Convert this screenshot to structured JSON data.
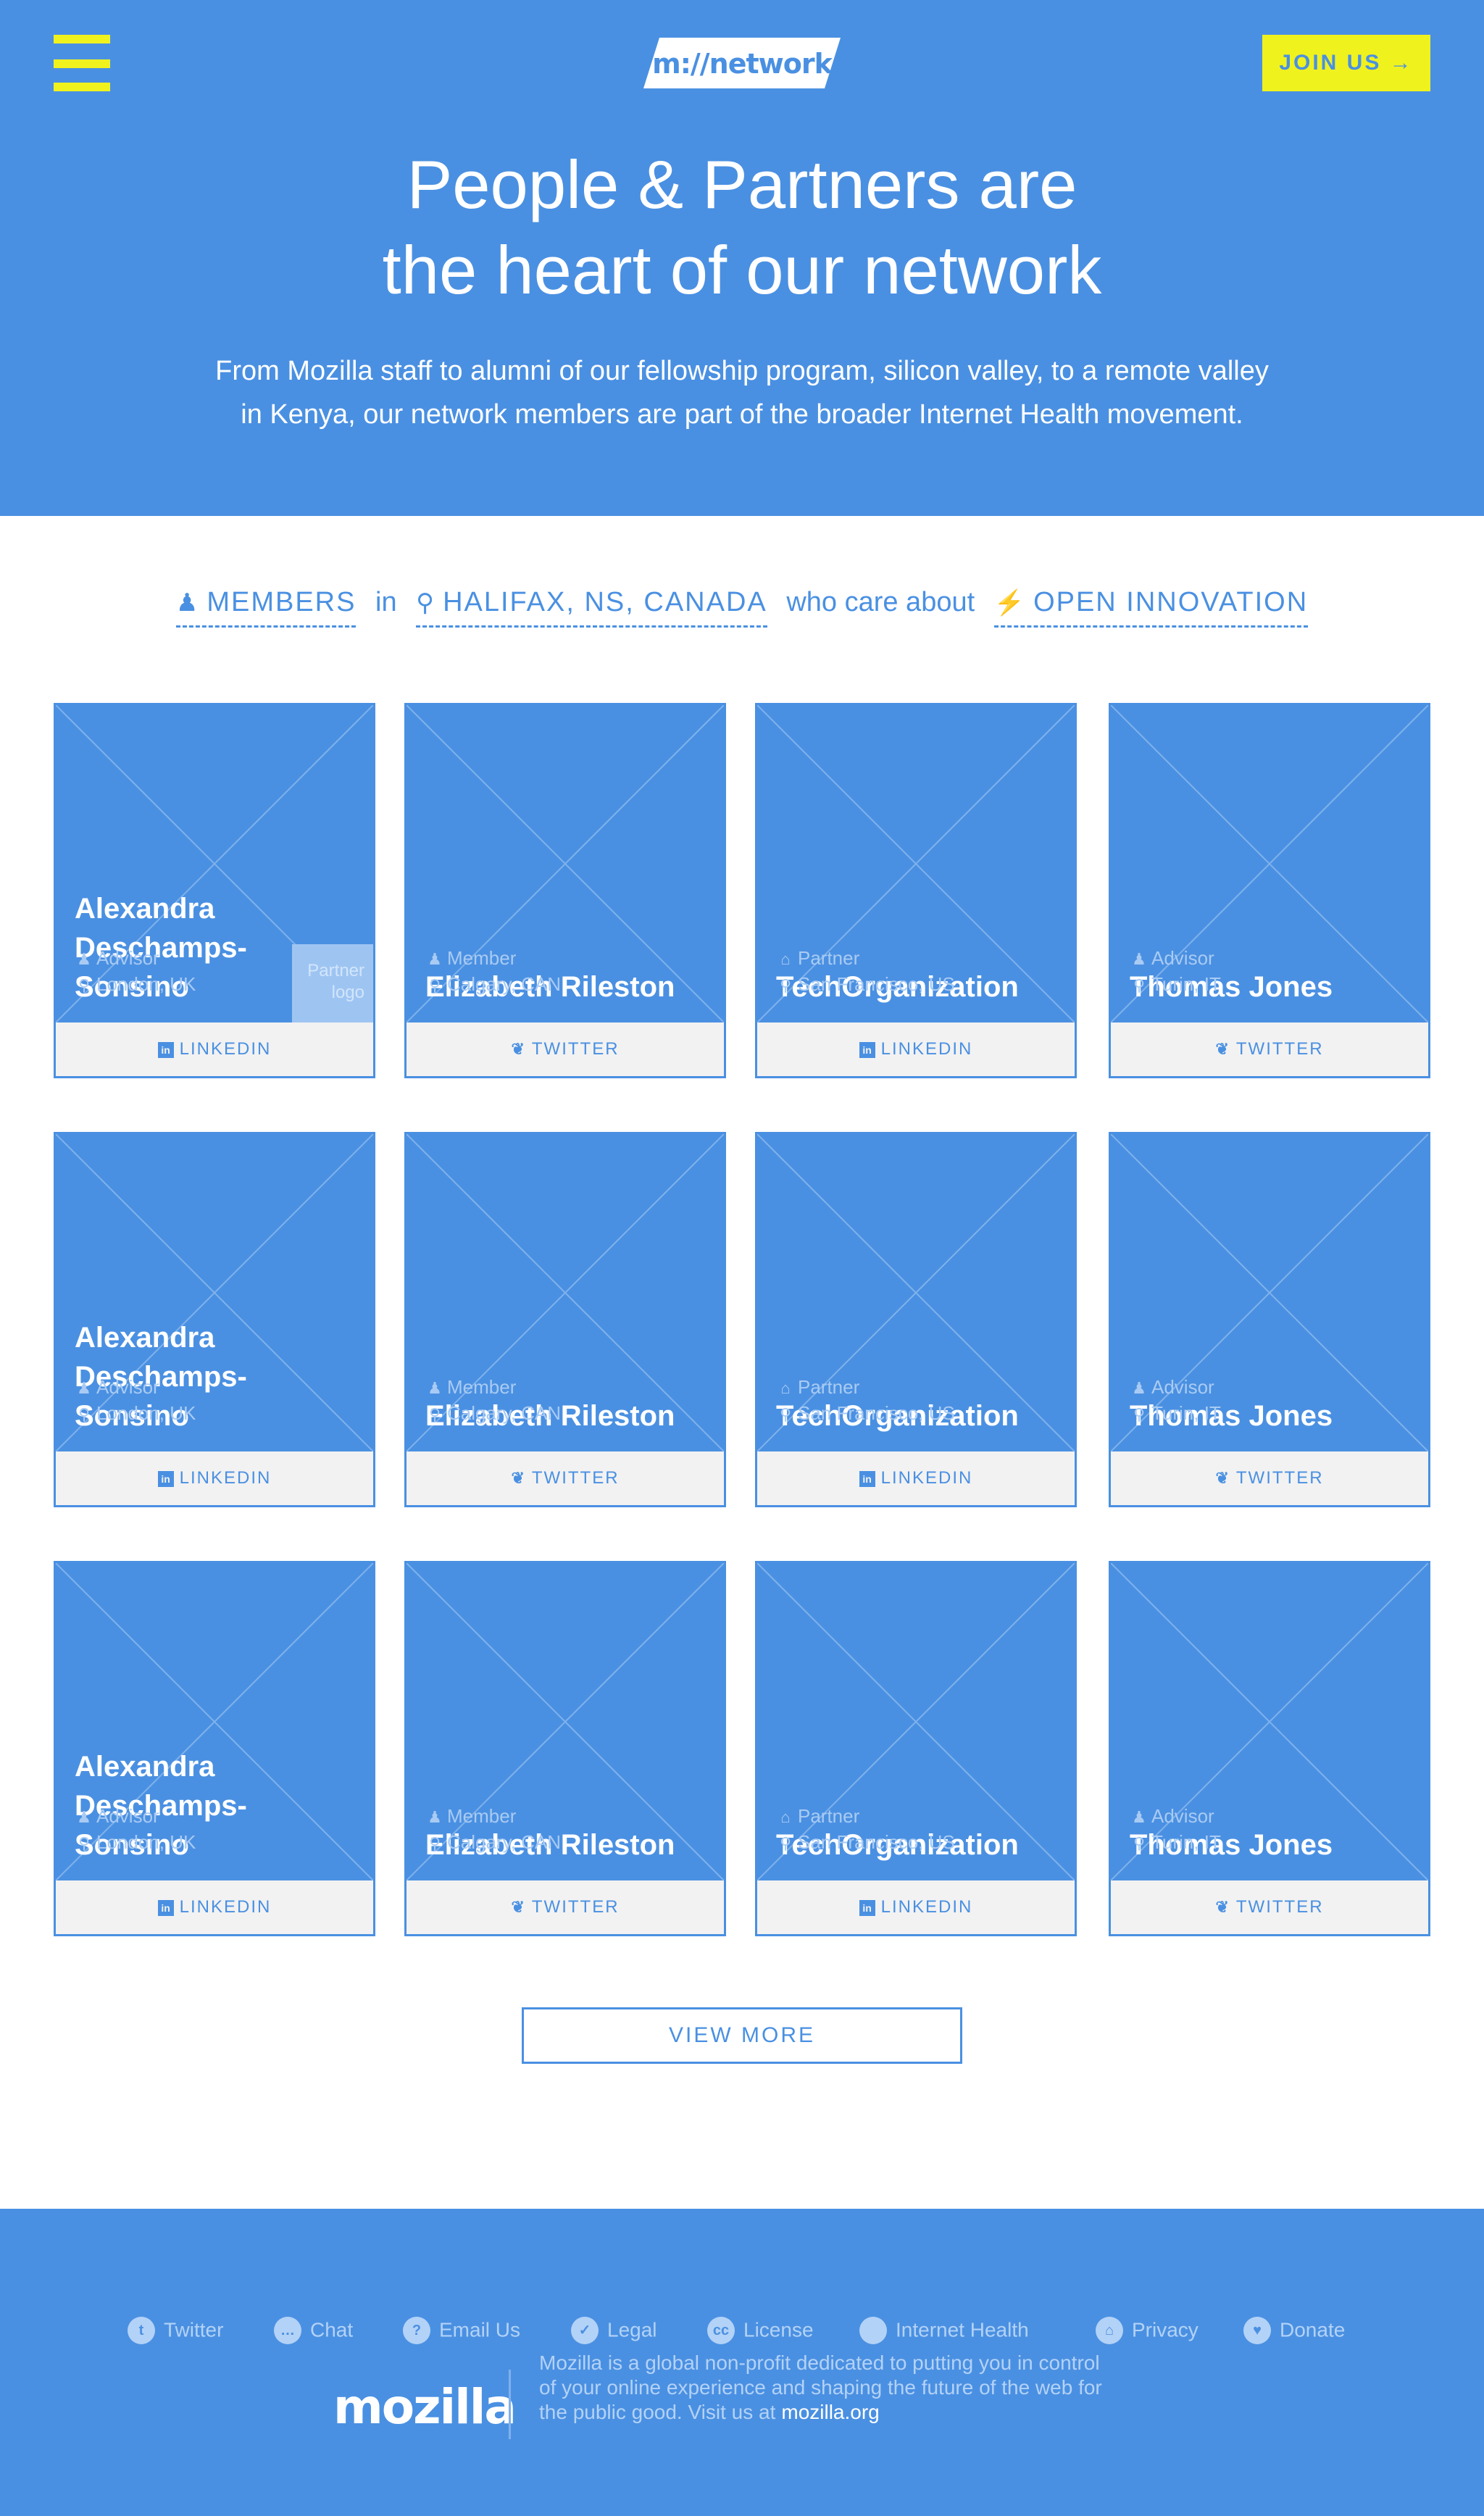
{
  "header": {
    "logo_text": "m://network",
    "join_label": "JOIN US →"
  },
  "hero": {
    "title_line1": "People & Partners are",
    "title_line2": "the heart of our network",
    "sub_line1": "From Mozilla staff to alumni of our fellowship program, silicon valley, to a remote valley",
    "sub_line2": "in Kenya, our network members are part of the broader Internet Health movement."
  },
  "filter": {
    "who_icon": "user-icon",
    "who": "MEMBERS",
    "in_text": "in",
    "where_icon": "map-pin-icon",
    "where": "HALIFAX, NS, CANADA",
    "care_text": "who care about",
    "topic_icon": "lightning-icon",
    "topic": "OPEN INNOVATION"
  },
  "cards": [
    {
      "name": "Alexandra Deschamps-Sonsino",
      "role": "Advisor",
      "role_icon": "user-icon",
      "location": "London, UK",
      "social": "LINKEDIN",
      "partner_logo": "Partner logo"
    },
    {
      "name": "Elizabeth Rileston",
      "role": "Member",
      "role_icon": "user-icon",
      "location": "Calgary, CAN",
      "social": "TWITTER"
    },
    {
      "name": "TechOrganization",
      "role": "Partner",
      "role_icon": "building-icon",
      "location": "San Francisco, US",
      "social": "LINKEDIN"
    },
    {
      "name": "Thomas Jones",
      "role": "Advisor",
      "role_icon": "user-icon",
      "location": "Turin, IT",
      "social": "TWITTER"
    },
    {
      "name": "Alexandra Deschamps-Sonsino",
      "role": "Advisor",
      "role_icon": "user-icon",
      "location": "London, UK",
      "social": "LINKEDIN"
    },
    {
      "name": "Elizabeth Rileston",
      "role": "Member",
      "role_icon": "user-icon",
      "location": "Calgary, CAN",
      "social": "TWITTER"
    },
    {
      "name": "TechOrganization",
      "role": "Partner",
      "role_icon": "building-icon",
      "location": "San Francisco, US",
      "social": "LINKEDIN"
    },
    {
      "name": "Thomas Jones",
      "role": "Advisor",
      "role_icon": "user-icon",
      "location": "Turin, IT",
      "social": "TWITTER"
    },
    {
      "name": "Alexandra Deschamps-Sonsino",
      "role": "Advisor",
      "role_icon": "user-icon",
      "location": "London, UK",
      "social": "LINKEDIN"
    },
    {
      "name": "Elizabeth Rileston",
      "role": "Member",
      "role_icon": "user-icon",
      "location": "Calgary, CAN",
      "social": "TWITTER"
    },
    {
      "name": "TechOrganization",
      "role": "Partner",
      "role_icon": "building-icon",
      "location": "San Francisco, US",
      "social": "LINKEDIN"
    },
    {
      "name": "Thomas Jones",
      "role": "Advisor",
      "role_icon": "user-icon",
      "location": "Turin, IT",
      "social": "TWITTER"
    }
  ],
  "view_more_label": "VIEW MORE",
  "footer": {
    "links": [
      {
        "label": "Twitter",
        "icon": "twitter-icon"
      },
      {
        "label": "Chat",
        "icon": "chat-icon"
      },
      {
        "label": "Email Us",
        "icon": "help-icon"
      },
      {
        "label": "Legal",
        "icon": "check-icon"
      },
      {
        "label": "License",
        "icon": "creative-commons-icon"
      },
      {
        "label": "Internet Health",
        "icon": "internet-health-icon"
      },
      {
        "label": "Privacy",
        "icon": "lock-icon"
      },
      {
        "label": "Donate",
        "icon": "heart-icon"
      }
    ],
    "logo_text": "mozilla",
    "text_line1": "Mozilla is a global non-profit dedicated to putting you in control",
    "text_line2": "of your online experience and shaping the future of the web for",
    "text_line3": "the public good. Visit us at",
    "org_link": "mozilla.org"
  },
  "colors": {
    "brand_blue": "#4a90e2",
    "accent_yellow": "#f0f21e"
  }
}
